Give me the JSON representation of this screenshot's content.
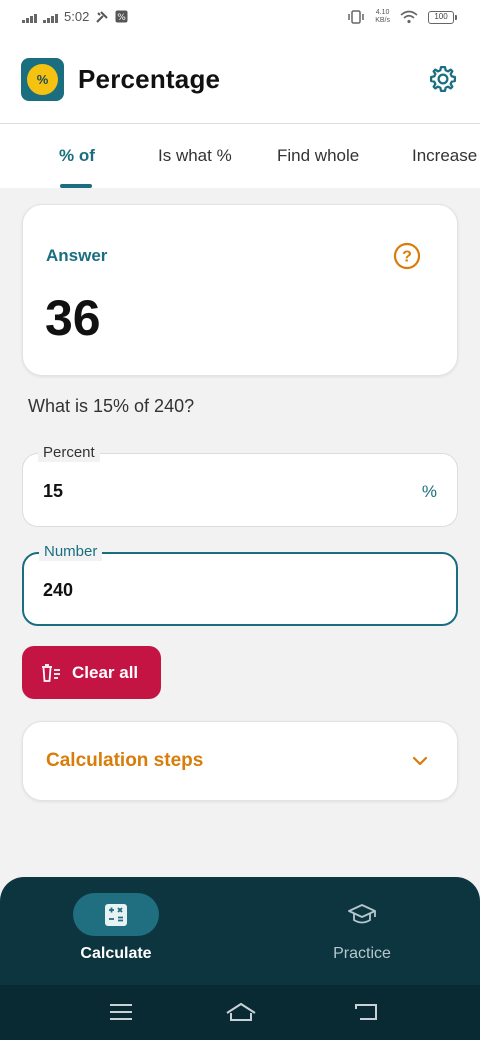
{
  "status_bar": {
    "time": "5:02",
    "net_speed_value": "4.10",
    "net_speed_unit": "KB/s",
    "battery": "100"
  },
  "app": {
    "title": "Percentage",
    "logo_symbol": "%"
  },
  "tabs": [
    {
      "label": "% of",
      "active": true
    },
    {
      "label": "Is what %",
      "active": false
    },
    {
      "label": "Find whole",
      "active": false
    },
    {
      "label": "Increase",
      "active": false
    }
  ],
  "answer": {
    "label": "Answer",
    "value": "36",
    "help_symbol": "?"
  },
  "question": "What is 15% of 240?",
  "fields": {
    "percent": {
      "label": "Percent",
      "value": "15",
      "suffix": "%"
    },
    "number": {
      "label": "Number",
      "value": "240"
    }
  },
  "clear_button": {
    "label": "Clear all"
  },
  "steps": {
    "label": "Calculation steps"
  },
  "bottom_nav": [
    {
      "label": "Calculate",
      "icon": "calculator-icon",
      "active": true
    },
    {
      "label": "Practice",
      "icon": "graduation-cap-icon",
      "active": false
    }
  ],
  "colors": {
    "primary": "#1a6e80",
    "danger": "#c41444",
    "accent_orange": "#d97c0a",
    "nav_bg": "#0d3540"
  }
}
